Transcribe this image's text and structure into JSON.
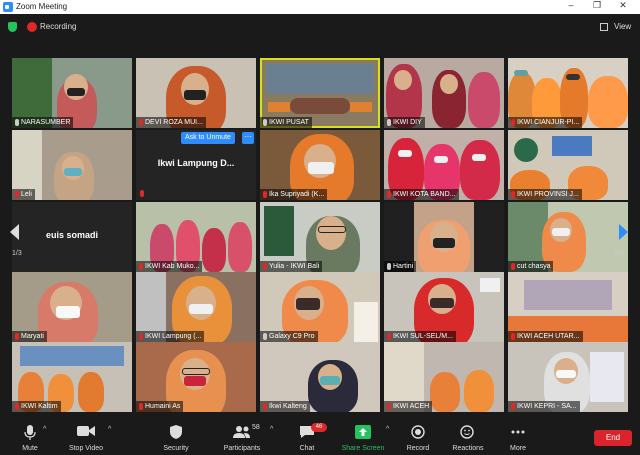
{
  "window": {
    "title": "Zoom Meeting",
    "minimize": "–",
    "maximize": "❐",
    "close": "✕"
  },
  "status": {
    "recording_label": "Recording",
    "view_label": "View"
  },
  "pager": {
    "left_count": "1/3",
    "right_count": "1/3"
  },
  "tiles": [
    {
      "name": "NARASUMBER",
      "muted": false
    },
    {
      "name": "DEVI ROZA MUI...",
      "muted": true
    },
    {
      "name": "IKWI PUSAT",
      "muted": false
    },
    {
      "name": "IKWI DIY",
      "muted": false
    },
    {
      "name": "IKWI CIANJUR-PI...",
      "muted": true
    },
    {
      "name": "Leli",
      "muted": true
    },
    {
      "name": "Ikwi Lampung D...",
      "muted": true
    },
    {
      "name": "Ika Supriyadi (K...",
      "muted": true
    },
    {
      "name": "IKWI KOTA BAND...",
      "muted": true
    },
    {
      "name": "IKWI PROVINSI J...",
      "muted": true
    },
    {
      "name": "euis somadi",
      "muted": true
    },
    {
      "name": "IKWI Kab Muko...",
      "muted": true
    },
    {
      "name": "Yulia - IKWI Bali",
      "muted": true
    },
    {
      "name": "Hartini",
      "muted": false
    },
    {
      "name": "cut chasya",
      "muted": true
    },
    {
      "name": "Maryati",
      "muted": true
    },
    {
      "name": "IKWI Lampung (...",
      "muted": true
    },
    {
      "name": "Galaxy C9 Pro",
      "muted": false
    },
    {
      "name": "IKWI SUL-SEL/M...",
      "muted": true
    },
    {
      "name": "IKWI ACEH UTAR...",
      "muted": true
    },
    {
      "name": "IKWI Kaltim",
      "muted": true
    },
    {
      "name": "Humaini As",
      "muted": true
    },
    {
      "name": "Ikwi Kalteng",
      "muted": true
    },
    {
      "name": "IKWI ACEH",
      "muted": true
    },
    {
      "name": "IKWI KEPRI - SA...",
      "muted": true
    }
  ],
  "unmute_button": "Ask to Unmute",
  "more_button": "···",
  "toolbar": {
    "mute": "Mute",
    "stop_video": "Stop Video",
    "security": "Security",
    "participants": "Participants",
    "participants_count": "58",
    "chat": "Chat",
    "chat_badge": "46",
    "share_screen": "Share Screen",
    "record": "Record",
    "reactions": "Reactions",
    "more": "More",
    "end": "End"
  },
  "colors": {
    "accent": "#2d8cff",
    "end": "#d8242a",
    "share": "#23c45e",
    "active_speaker": "#d4e21a"
  }
}
